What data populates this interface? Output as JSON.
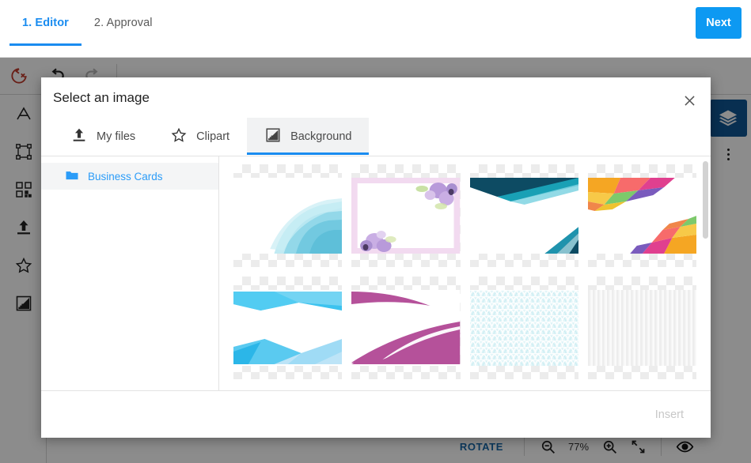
{
  "stepbar": {
    "steps": [
      {
        "label": "1. Editor",
        "active": true
      },
      {
        "label": "2. Approval",
        "active": false
      }
    ],
    "next_label": "Next",
    "accent_color": "#1a8cf0"
  },
  "editor": {
    "top_toolbar": [
      {
        "name": "reset-icon",
        "title": "Reset"
      },
      {
        "name": "undo-icon",
        "title": "Undo"
      },
      {
        "name": "redo-icon",
        "title": "Redo"
      }
    ],
    "left_toolbar": [
      {
        "name": "text-icon",
        "title": "A"
      },
      {
        "name": "transform-icon",
        "title": "Transform"
      },
      {
        "name": "qr-code-icon",
        "title": "QR Code"
      },
      {
        "name": "upload-icon",
        "title": "Upload"
      },
      {
        "name": "star-icon",
        "title": "Clipart"
      },
      {
        "name": "background-icon",
        "title": "Background"
      }
    ],
    "right_toolbar": {
      "layers_icon": "layers-icon",
      "layers_bg": "#105694",
      "more_icon": "more-vertical-icon"
    },
    "bottom_bar": {
      "rotate_label": "ROTATE",
      "zoom_out_icon": "zoom-out-icon",
      "zoom_value": "77%",
      "zoom_in_icon": "zoom-in-icon",
      "fit_icon": "fit-screen-icon",
      "preview_icon": "eye-icon"
    }
  },
  "modal": {
    "title": "Select an image",
    "close_icon": "close-icon",
    "tabs": [
      {
        "label": "My files",
        "icon": "upload-icon",
        "active": false
      },
      {
        "label": "Clipart",
        "icon": "star-icon",
        "active": false
      },
      {
        "label": "Background",
        "icon": "background-icon",
        "active": true
      }
    ],
    "folders": [
      {
        "label": "Business Cards",
        "icon": "folder-icon",
        "selected": true
      }
    ],
    "thumbnails": [
      {
        "name": "watercolor-blue-wash",
        "style": "blue-wash"
      },
      {
        "name": "purple-floral-frame",
        "style": "floral-frame"
      },
      {
        "name": "teal-navy-diagonal",
        "style": "teal-navy"
      },
      {
        "name": "rainbow-polygon",
        "style": "rainbow-poly"
      },
      {
        "name": "cyan-ribbon-bands",
        "style": "cyan-bands"
      },
      {
        "name": "magenta-swoosh",
        "style": "magenta-swoosh"
      },
      {
        "name": "light-blue-wave-pattern",
        "style": "blue-pattern"
      },
      {
        "name": "gray-vertical-stripes",
        "style": "gray-stripes"
      }
    ],
    "insert_label": "Insert",
    "insert_enabled": false
  }
}
